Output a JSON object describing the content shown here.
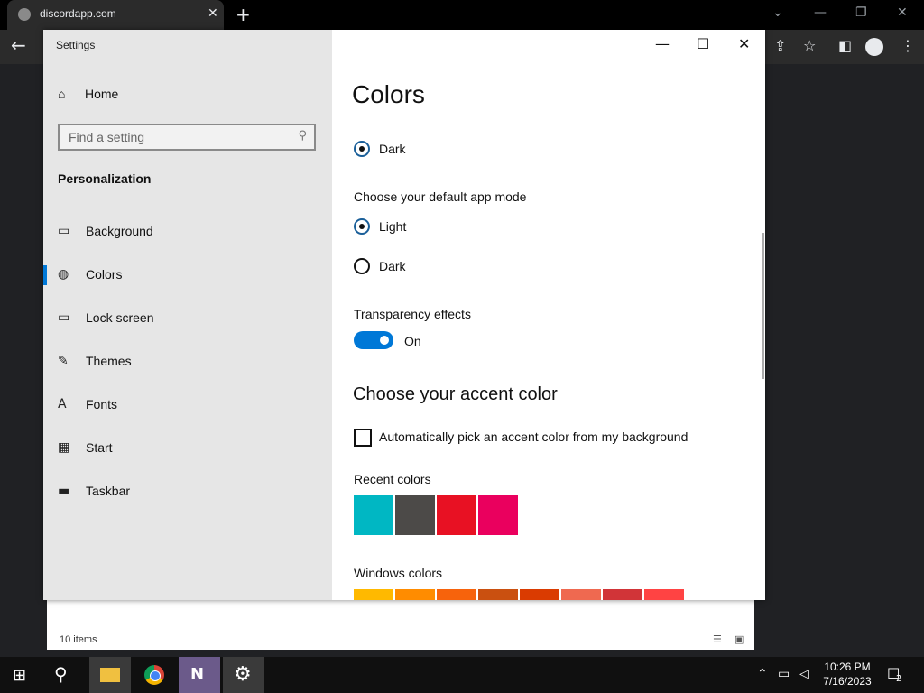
{
  "browser": {
    "tab_title": "discordapp.com",
    "new_tab": "+",
    "tab_close": "✕"
  },
  "explorer": {
    "items_count": "10 items"
  },
  "settings": {
    "window_title": "Settings",
    "home_label": "Home",
    "search_placeholder": "Find a setting",
    "section": "Personalization",
    "nav_items": [
      {
        "label": "Background",
        "icon": "image-icon"
      },
      {
        "label": "Colors",
        "icon": "palette-icon",
        "selected": true
      },
      {
        "label": "Lock screen",
        "icon": "lock-screen-icon"
      },
      {
        "label": "Themes",
        "icon": "themes-icon"
      },
      {
        "label": "Fonts",
        "icon": "fonts-icon"
      },
      {
        "label": "Start",
        "icon": "start-icon"
      },
      {
        "label": "Taskbar",
        "icon": "taskbar-icon"
      }
    ],
    "page_title": "Colors",
    "windows_mode_dark": "Dark",
    "app_mode_heading": "Choose your default app mode",
    "app_mode_light": "Light",
    "app_mode_dark": "Dark",
    "transparency_heading": "Transparency effects",
    "transparency_state": "On",
    "accent_heading": "Choose your accent color",
    "auto_pick_label": "Automatically pick an accent color from my background",
    "recent_colors_heading": "Recent colors",
    "recent_colors": [
      "#00b7c3",
      "#4c4a48",
      "#e81123",
      "#ea005e"
    ],
    "windows_colors_heading": "Windows colors",
    "windows_colors": [
      "#ffb900",
      "#ff8c00",
      "#f7630c",
      "#ca5010",
      "#da3b01",
      "#ef6950",
      "#d13438",
      "#ff4343"
    ]
  },
  "taskbar": {
    "time": "10:26 PM",
    "date": "7/16/2023",
    "notifications": "2"
  }
}
